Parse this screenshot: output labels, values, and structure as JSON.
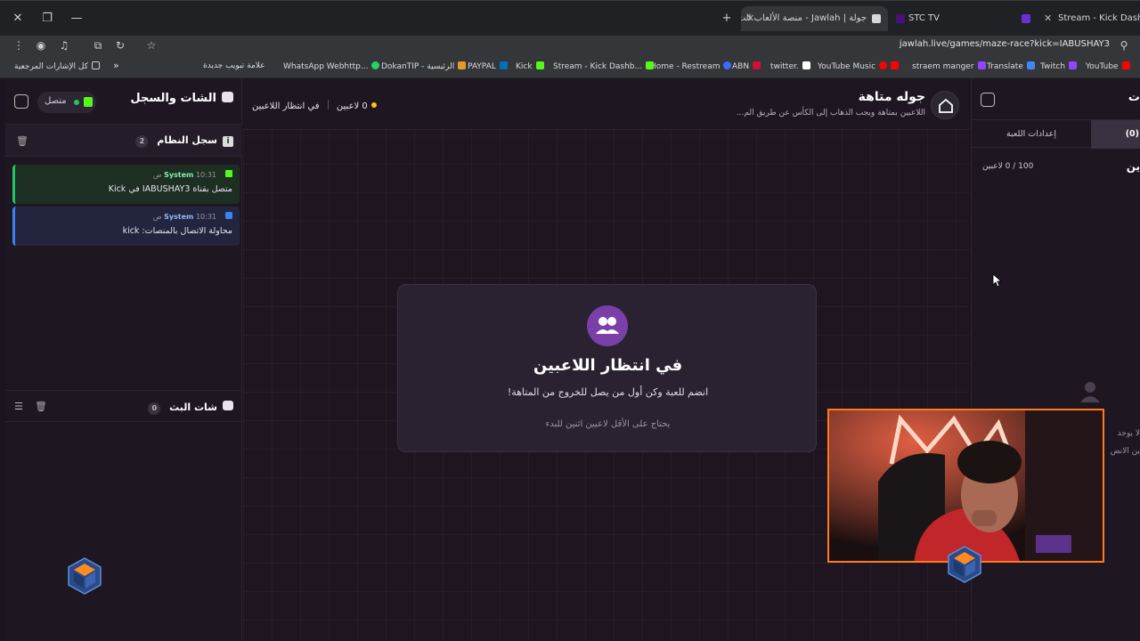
{
  "browser": {
    "tabs": [
      {
        "label": "Stream - Kick Dashboard",
        "icon_color": "#53fc18"
      },
      {
        "label": "",
        "icon_color": "#6b2fd6"
      },
      {
        "label": "STC TV",
        "icon_color": "#4b0f7a"
      },
      {
        "label": "جولة | Jawlah - منصة الألعاب الت",
        "icon_color": "#d8d8d8"
      }
    ],
    "url": "jawlah.live/games/maze-race?kick=IABUSHAY3",
    "bookmarks": [
      {
        "label": "YouTube",
        "icon_color": "#ff0000"
      },
      {
        "label": "Twitch",
        "icon_color": "#9146ff"
      },
      {
        "label": "Translate",
        "icon_color": "#4285f4"
      },
      {
        "label": "straem manger",
        "icon_color": "#9146ff"
      },
      {
        "label": "YouTube Music",
        "icon_color": "#ff0000"
      },
      {
        "label": "twitter.",
        "icon_color": "#ffffff"
      },
      {
        "label": "ABN",
        "icon_color": "#d0103a"
      },
      {
        "label": "Home - Restream",
        "icon_color": "#3a6bff"
      },
      {
        "label": "Stream - Kick Dashb...",
        "icon_color": "#53fc18"
      },
      {
        "label": "Kick",
        "icon_color": "#53fc18"
      },
      {
        "label": "PAYPAL",
        "icon_color": "#0070ba"
      },
      {
        "label": "DokanTIP - الرئيسية",
        "icon_color": "#e39b2c"
      },
      {
        "label": "WhatsApp Webhttp...",
        "icon_color": "#25d366"
      },
      {
        "label": "علامة تبويب جديدة",
        "icon_color": ""
      },
      {
        "label": "كل الإشارات المرجعية",
        "icon_color": ""
      }
    ]
  },
  "left_panel": {
    "title": "الشات والسجل",
    "status": "متصل",
    "system_log": {
      "title": "سجل النظام",
      "count": "2",
      "entries": [
        {
          "sender": "System",
          "time": "10:31 ص",
          "text": "متصل بقناة IABUSHAY3 في Kick",
          "accent": "#22c55e",
          "badge_color": "#53fc18"
        },
        {
          "sender": "System",
          "time": "10:31 ص",
          "text": "محاولة الاتصال بالمنصات: kick",
          "accent": "#3b82f6",
          "badge_color": "#3b82f6"
        }
      ]
    },
    "stream_chat": {
      "title": "شات البث",
      "count": "0"
    }
  },
  "header": {
    "title": "جوله متاهة",
    "subtitle": "اللاعبين بمتاهة ويجب الذهاب إلى الكأس عن طريق الم...",
    "state": "في انتظار اللاعبين",
    "players": "0 لاعبين"
  },
  "card": {
    "title": "في انتظار اللاعبين",
    "subtitle": "انضم للعبة وكن أول من يصل للخروج من المتاهة!",
    "hint": "يحتاج على الأقل لاعبين اثنين للبدء"
  },
  "right_panel": {
    "tab_players": "(0)",
    "tab_settings": "إعدادات اللعبة",
    "count_label": "100 / 0 لاعبين",
    "heading_fragment": "ين",
    "empty_line1": "لا يوجد",
    "empty_line2": "ين الانض",
    "header_fragment": "ت"
  },
  "colors": {
    "accent_purple": "#7b3fa8",
    "online_green": "#22c55e",
    "waiting_dot": "#f5c518"
  }
}
